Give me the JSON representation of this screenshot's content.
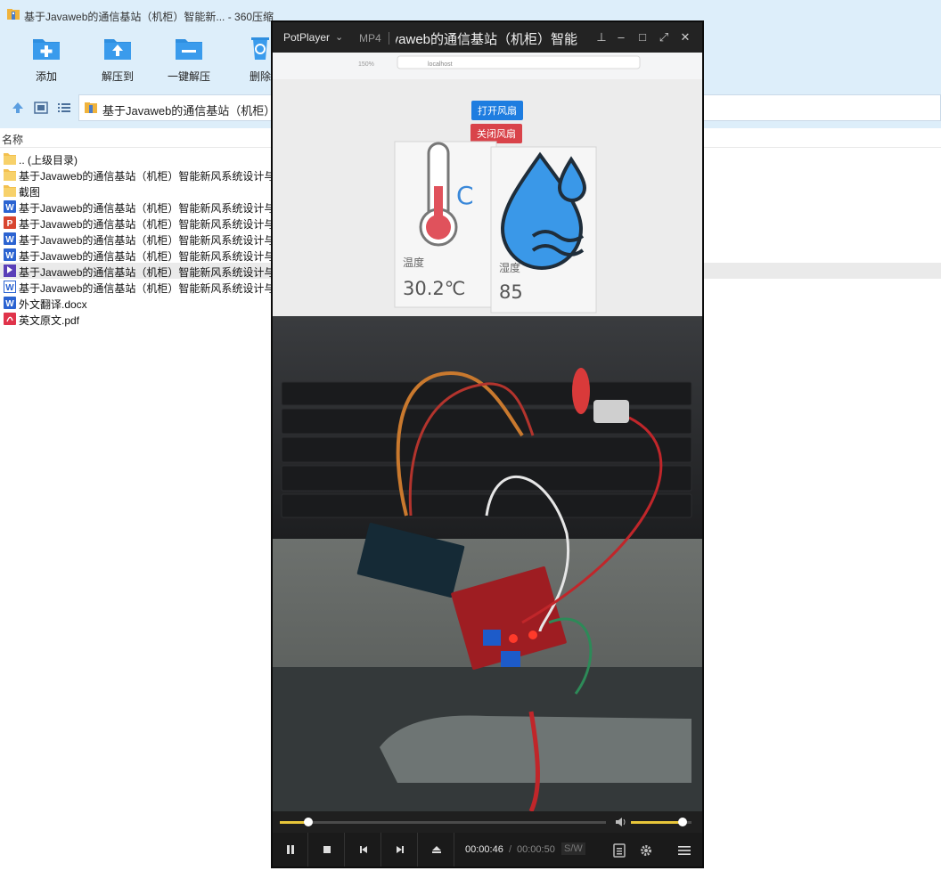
{
  "zip_window": {
    "title": "基于Javaweb的通信基站（机柜）智能新... - 360压缩",
    "toolbar": [
      {
        "label": "添加",
        "icon": "add-folder-icon"
      },
      {
        "label": "解压到",
        "icon": "extract-to-icon"
      },
      {
        "label": "一键解压",
        "icon": "one-click-extract-icon"
      },
      {
        "label": "删除",
        "icon": "recycle-icon"
      }
    ],
    "address": "基于Javaweb的通信基站（机柜）智",
    "column_name": "名称",
    "files": [
      {
        "name": ".. (上级目录)",
        "type": "folder"
      },
      {
        "name": "基于Javaweb的通信基站（机柜）智能新风系统设计与",
        "type": "folder"
      },
      {
        "name": "截图",
        "type": "folder"
      },
      {
        "name": "基于Javaweb的通信基站（机柜）智能新风系统设计与",
        "type": "word"
      },
      {
        "name": "基于Javaweb的通信基站（机柜）智能新风系统设计与",
        "type": "ppt"
      },
      {
        "name": "基于Javaweb的通信基站（机柜）智能新风系统设计与",
        "type": "word"
      },
      {
        "name": "基于Javaweb的通信基站（机柜）智能新风系统设计与",
        "type": "word"
      },
      {
        "name": "基于Javaweb的通信基站（机柜）智能新风系统设计与",
        "type": "mp4"
      },
      {
        "name": "基于Javaweb的通信基站（机柜）智能新风系统设计与",
        "type": "word-outline"
      },
      {
        "name": "外文翻译.docx",
        "type": "word"
      },
      {
        "name": "英文原文.pdf",
        "type": "pdf"
      }
    ]
  },
  "player": {
    "brand": "PotPlayer",
    "format": "MP4",
    "title": "基于Javaweb的通信基站（机柜）智能",
    "video": {
      "browser_zoom": "150%",
      "browser_url": "localhost",
      "btn_open_fan": "打开风扇",
      "btn_close_fan": "关闭风扇",
      "temp_label": "温度",
      "temp_value": "30.2℃",
      "humid_label": "湿度",
      "humid_value": "85"
    },
    "progress_fraction": 0.087,
    "volume_fraction": 0.85,
    "time_current": "00:00:46",
    "time_separator": "/",
    "time_total": "00:00:50",
    "sw_badge": "S/W",
    "accent_color": "#e8c63a"
  }
}
